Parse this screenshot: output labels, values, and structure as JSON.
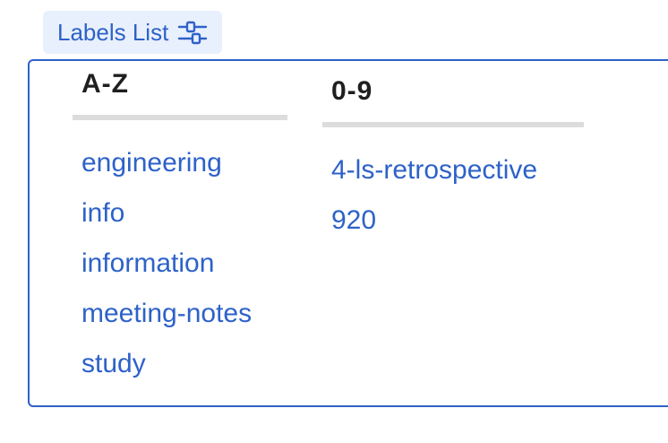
{
  "toolbar": {
    "labels_list_button": "Labels List",
    "labels_list_icon": "sliders-icon"
  },
  "columns": [
    {
      "heading": "A-Z",
      "items": [
        "engineering",
        "info",
        "information",
        "meeting-notes",
        "study"
      ]
    },
    {
      "heading": "0-9",
      "items": [
        "4-ls-retrospective",
        "920"
      ]
    }
  ],
  "colors": {
    "accent": "#2d62c8",
    "button_bg": "#e9f0fd",
    "rule": "#dcdcdc",
    "heading": "#1f1f1f"
  }
}
